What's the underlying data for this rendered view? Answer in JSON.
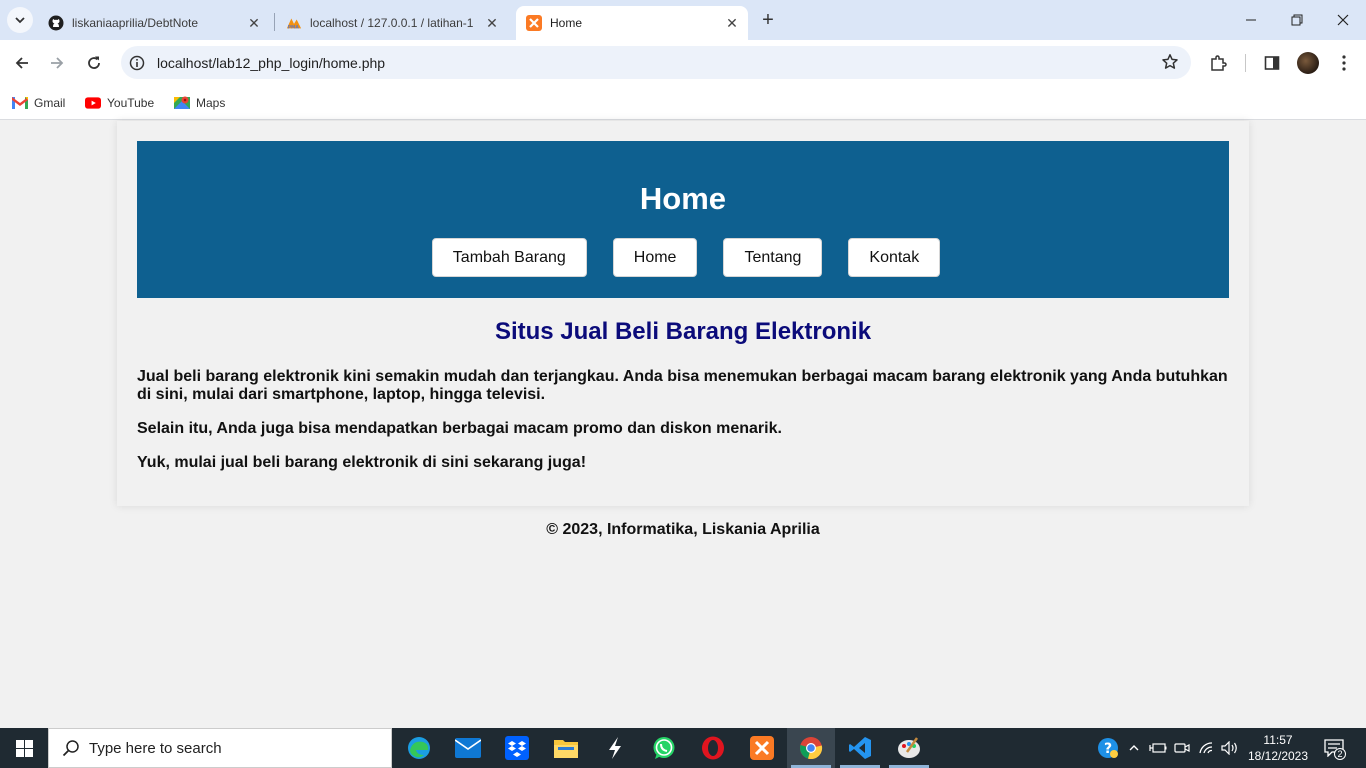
{
  "browser": {
    "tabs": [
      {
        "title": "liskaniaaprilia/DebtNote",
        "icon": "github-icon",
        "active": false
      },
      {
        "title": "localhost / 127.0.0.1 / latihan-1",
        "icon": "phpmyadmin-icon",
        "active": false
      },
      {
        "title": "Home",
        "icon": "xampp-icon",
        "active": true
      }
    ],
    "url": "localhost/lab12_php_login/home.php",
    "bookmarks": [
      {
        "label": "Gmail",
        "icon": "gmail-icon"
      },
      {
        "label": "YouTube",
        "icon": "youtube-icon"
      },
      {
        "label": "Maps",
        "icon": "maps-icon"
      }
    ]
  },
  "page": {
    "header_title": "Home",
    "nav": [
      "Tambah Barang",
      "Home",
      "Tentang",
      "Kontak"
    ],
    "heading": "Situs Jual Beli Barang Elektronik",
    "paragraphs": [
      "Jual beli barang elektronik kini semakin mudah dan terjangkau. Anda bisa menemukan berbagai macam barang elektronik yang Anda butuhkan di sini, mulai dari smartphone, laptop, hingga televisi.",
      "Selain itu, Anda juga bisa mendapatkan berbagai macam promo dan diskon menarik.",
      "Yuk, mulai jual beli barang elektronik di sini sekarang juga!"
    ],
    "footer": "© 2023, Informatika, Liskania Aprilia",
    "colors": {
      "header_bg": "#0e6090",
      "heading": "#0b0b7a",
      "page_bg": "#f1f1f1"
    }
  },
  "taskbar": {
    "search_placeholder": "Type here to search",
    "time": "11:57",
    "date": "18/12/2023",
    "notification_count": "2",
    "apps": [
      "edge-icon",
      "mail-icon",
      "dropbox-icon",
      "file-explorer-icon",
      "stackedit-icon",
      "whatsapp-icon",
      "opera-icon",
      "xampp-icon",
      "chrome-icon",
      "vscode-icon",
      "paint-icon"
    ]
  }
}
